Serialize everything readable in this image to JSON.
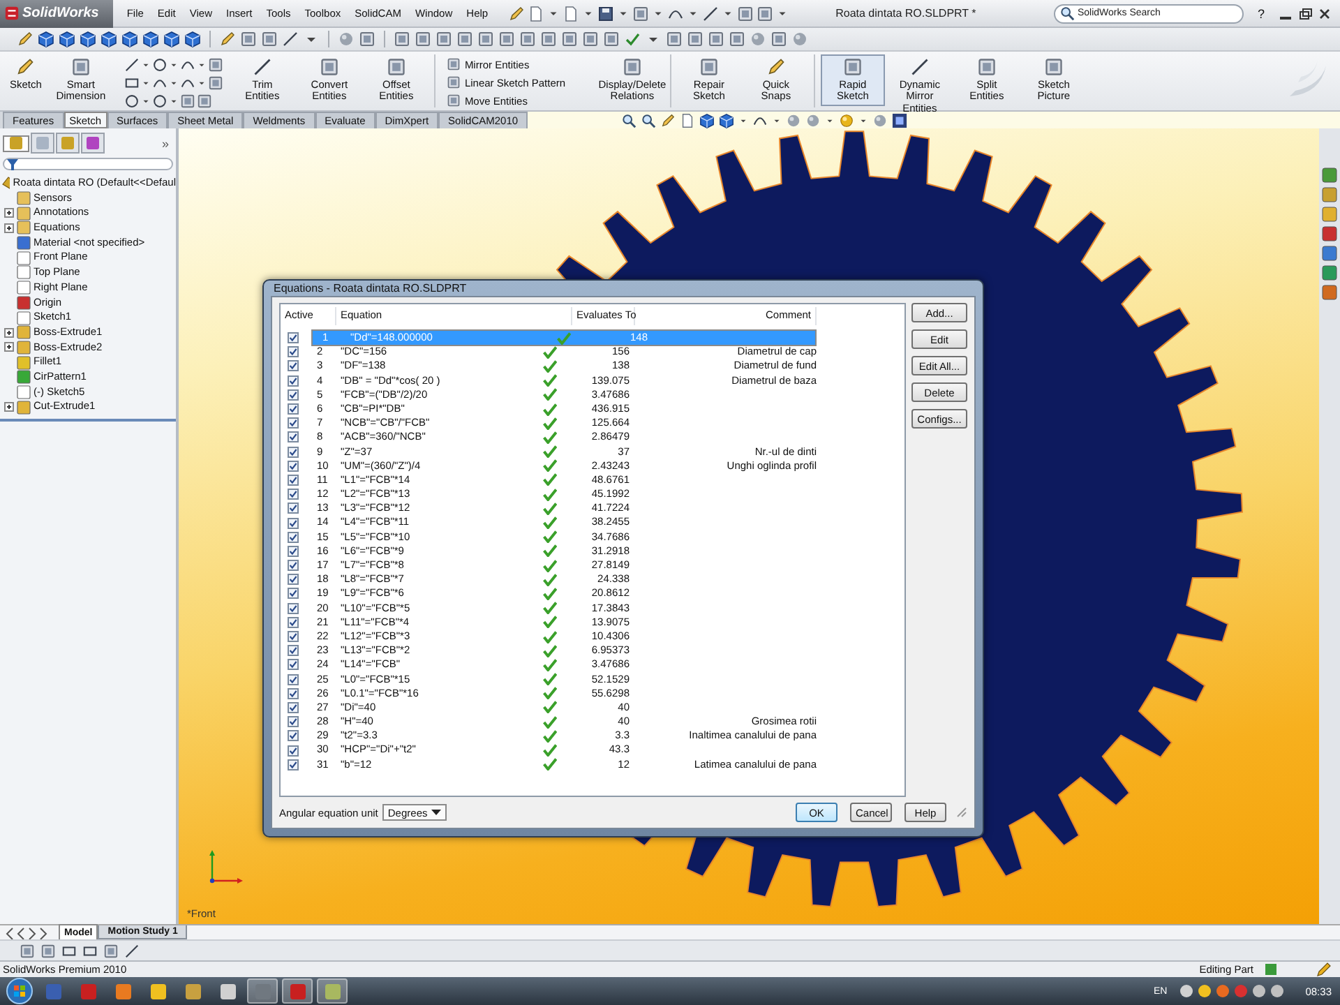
{
  "window": {
    "app_name": "SolidWorks",
    "title": "Roata dintata RO.SLDPRT *"
  },
  "menu": [
    "File",
    "Edit",
    "View",
    "Insert",
    "Tools",
    "Toolbox",
    "SolidCAM",
    "Window",
    "Help"
  ],
  "search": {
    "placeholder": "SolidWorks Search"
  },
  "help_button": "?",
  "command_manager": [
    {
      "kind": "large",
      "label": "Sketch",
      "on": false
    },
    {
      "kind": "large",
      "label": "Smart Dimension",
      "on": false
    },
    {
      "kind": "large",
      "label": "Trim Entities",
      "on": false
    },
    {
      "kind": "large",
      "label": "Convert Entities",
      "on": false
    },
    {
      "kind": "large",
      "label": "Offset Entities",
      "on": false
    },
    {
      "kind": "small",
      "label": "Mirror Entities"
    },
    {
      "kind": "small",
      "label": "Linear Sketch Pattern"
    },
    {
      "kind": "small",
      "label": "Move Entities"
    },
    {
      "kind": "large",
      "label": "Display/Delete Relations",
      "on": false
    },
    {
      "kind": "large",
      "label": "Repair Sketch",
      "on": false
    },
    {
      "kind": "large",
      "label": "Quick Snaps",
      "on": false
    },
    {
      "kind": "large",
      "label": "Rapid Sketch",
      "on": true
    },
    {
      "kind": "large",
      "label": "Dynamic Mirror Entities",
      "on": false
    },
    {
      "kind": "large",
      "label": "Split Entities",
      "on": false
    },
    {
      "kind": "large",
      "label": "Sketch Picture",
      "on": false
    }
  ],
  "tabs": [
    {
      "label": "Features",
      "selected": false
    },
    {
      "label": "Sketch",
      "selected": true
    },
    {
      "label": "Surfaces",
      "selected": false
    },
    {
      "label": "Sheet Metal",
      "selected": false
    },
    {
      "label": "Weldments",
      "selected": false
    },
    {
      "label": "Evaluate",
      "selected": false
    },
    {
      "label": "DimXpert",
      "selected": false
    },
    {
      "label": "SolidCAM2010",
      "selected": false
    }
  ],
  "panel_tabs": [
    {
      "selected": true
    },
    {
      "selected": false
    },
    {
      "selected": false
    },
    {
      "selected": false
    }
  ],
  "feature_tree": {
    "more_button": "»",
    "root": "Roata dintata RO  (Default<<Defaul",
    "items": [
      {
        "label": "Sensors",
        "kind": "sensors",
        "collapsed": false
      },
      {
        "label": "Annotations",
        "kind": "annotations",
        "collapsed": true
      },
      {
        "label": "Equations",
        "kind": "equations",
        "collapsed": true
      },
      {
        "label": "Material <not specified>",
        "kind": "material",
        "collapsed": false
      },
      {
        "label": "Front Plane",
        "kind": "plane",
        "collapsed": false
      },
      {
        "label": "Top Plane",
        "kind": "plane",
        "collapsed": false
      },
      {
        "label": "Right Plane",
        "kind": "plane",
        "collapsed": false
      },
      {
        "label": "Origin",
        "kind": "origin",
        "collapsed": false
      },
      {
        "label": "Sketch1",
        "kind": "sketch",
        "collapsed": false
      },
      {
        "label": "Boss-Extrude1",
        "kind": "extrude",
        "collapsed": true
      },
      {
        "label": "Boss-Extrude2",
        "kind": "extrude",
        "collapsed": true
      },
      {
        "label": "Fillet1",
        "kind": "fillet",
        "collapsed": false
      },
      {
        "label": "CirPattern1",
        "kind": "pattern",
        "collapsed": false
      },
      {
        "label": "(-) Sketch5",
        "kind": "sketch",
        "collapsed": false
      },
      {
        "label": "Cut-Extrude1",
        "kind": "cut",
        "collapsed": true
      }
    ]
  },
  "viewport": {
    "view_label": "*Front"
  },
  "dialog": {
    "title": "Equations - Roata dintata RO.SLDPRT",
    "columns": [
      "Active",
      "Equation",
      "Evaluates To",
      "Comment"
    ],
    "rows": [
      {
        "active": true,
        "selected": true,
        "number": "1",
        "equation": "\"Dd\"=148.000000",
        "valid": true,
        "value": "148"
      },
      {
        "active": true,
        "selected": false,
        "number": "2",
        "equation": "\"DC\"=156",
        "valid": true,
        "value": "156",
        "comment": "Diametrul de cap"
      },
      {
        "active": true,
        "selected": false,
        "number": "3",
        "equation": "\"DF\"=138",
        "valid": true,
        "value": "138",
        "comment": "Diametrul de fund"
      },
      {
        "active": true,
        "selected": false,
        "number": "4",
        "equation": "\"DB\" = \"Dd\"*cos( 20 )",
        "valid": true,
        "value": "139.075",
        "comment": "Diametrul de baza"
      },
      {
        "active": true,
        "selected": false,
        "number": "5",
        "equation": "\"FCB\"=(\"DB\"/2)/20",
        "valid": true,
        "value": "3.47686"
      },
      {
        "active": true,
        "selected": false,
        "number": "6",
        "equation": "\"CB\"=PI*\"DB\"",
        "valid": true,
        "value": "436.915"
      },
      {
        "active": true,
        "selected": false,
        "number": "7",
        "equation": "\"NCB\"=\"CB\"/\"FCB\"",
        "valid": true,
        "value": "125.664"
      },
      {
        "active": true,
        "selected": false,
        "number": "8",
        "equation": "\"ACB\"=360/\"NCB\"",
        "valid": true,
        "value": "2.86479"
      },
      {
        "active": true,
        "selected": false,
        "number": "9",
        "equation": "\"Z\"=37",
        "valid": true,
        "value": "37",
        "comment": "Nr.-ul de dinti"
      },
      {
        "active": true,
        "selected": false,
        "number": "10",
        "equation": "\"UM\"=(360/\"Z\")/4",
        "valid": true,
        "value": "2.43243",
        "comment": "Unghi oglinda profil"
      },
      {
        "active": true,
        "selected": false,
        "number": "11",
        "equation": "\"L1\"=\"FCB\"*14",
        "valid": true,
        "value": "48.6761"
      },
      {
        "active": true,
        "selected": false,
        "number": "12",
        "equation": "\"L2\"=\"FCB\"*13",
        "valid": true,
        "value": "45.1992"
      },
      {
        "active": true,
        "selected": false,
        "number": "13",
        "equation": "\"L3\"=\"FCB\"*12",
        "valid": true,
        "value": "41.7224"
      },
      {
        "active": true,
        "selected": false,
        "number": "14",
        "equation": "\"L4\"=\"FCB\"*11",
        "valid": true,
        "value": "38.2455"
      },
      {
        "active": true,
        "selected": false,
        "number": "15",
        "equation": "\"L5\"=\"FCB\"*10",
        "valid": true,
        "value": "34.7686"
      },
      {
        "active": true,
        "selected": false,
        "number": "16",
        "equation": "\"L6\"=\"FCB\"*9",
        "valid": true,
        "value": "31.2918"
      },
      {
        "active": true,
        "selected": false,
        "number": "17",
        "equation": "\"L7\"=\"FCB\"*8",
        "valid": true,
        "value": "27.8149"
      },
      {
        "active": true,
        "selected": false,
        "number": "18",
        "equation": "\"L8\"=\"FCB\"*7",
        "valid": true,
        "value": "24.338"
      },
      {
        "active": true,
        "selected": false,
        "number": "19",
        "equation": "\"L9\"=\"FCB\"*6",
        "valid": true,
        "value": "20.8612"
      },
      {
        "active": true,
        "selected": false,
        "number": "20",
        "equation": "\"L10\"=\"FCB\"*5",
        "valid": true,
        "value": "17.3843"
      },
      {
        "active": true,
        "selected": false,
        "number": "21",
        "equation": "\"L11\"=\"FCB\"*4",
        "valid": true,
        "value": "13.9075"
      },
      {
        "active": true,
        "selected": false,
        "number": "22",
        "equation": "\"L12\"=\"FCB\"*3",
        "valid": true,
        "value": "10.4306"
      },
      {
        "active": true,
        "selected": false,
        "number": "23",
        "equation": "\"L13\"=\"FCB\"*2",
        "valid": true,
        "value": "6.95373"
      },
      {
        "active": true,
        "selected": false,
        "number": "24",
        "equation": "\"L14\"=\"FCB\"",
        "valid": true,
        "value": "3.47686"
      },
      {
        "active": true,
        "selected": false,
        "number": "25",
        "equation": "\"L0\"=\"FCB\"*15",
        "valid": true,
        "value": "52.1529"
      },
      {
        "active": true,
        "selected": false,
        "number": "26",
        "equation": "\"L0.1\"=\"FCB\"*16",
        "valid": true,
        "value": "55.6298"
      },
      {
        "active": true,
        "selected": false,
        "number": "27",
        "equation": "\"Di\"=40",
        "valid": true,
        "value": "40"
      },
      {
        "active": true,
        "selected": false,
        "number": "28",
        "equation": "\"H\"=40",
        "valid": true,
        "value": "40",
        "comment": "Grosimea rotii"
      },
      {
        "active": true,
        "selected": false,
        "number": "29",
        "equation": "\"t2\"=3.3",
        "valid": true,
        "value": "3.3",
        "comment": "Inaltimea canalului de pana"
      },
      {
        "active": true,
        "selected": false,
        "number": "30",
        "equation": "\"HCP\"=\"Di\"+\"t2\"",
        "valid": true,
        "value": "43.3"
      },
      {
        "active": true,
        "selected": false,
        "number": "31",
        "equation": "\"b\"=12",
        "valid": true,
        "value": "12",
        "comment": "Latimea canalului de pana"
      }
    ],
    "side_buttons": [
      "Add...",
      "Edit",
      "Edit All...",
      "Delete",
      "Configs..."
    ],
    "angular_unit": {
      "label": "Angular equation unit",
      "value": "Degrees"
    },
    "footer_buttons": [
      "OK",
      "Cancel",
      "Help"
    ]
  },
  "bottom_tabs": [
    {
      "label": "Model",
      "selected": true
    },
    {
      "label": "Motion Study 1",
      "selected": false
    }
  ],
  "status_bar": {
    "product": "SolidWorks Premium 2010",
    "mode": "Editing Part"
  },
  "taskbar": {
    "language": "EN",
    "time": "08:33"
  }
}
